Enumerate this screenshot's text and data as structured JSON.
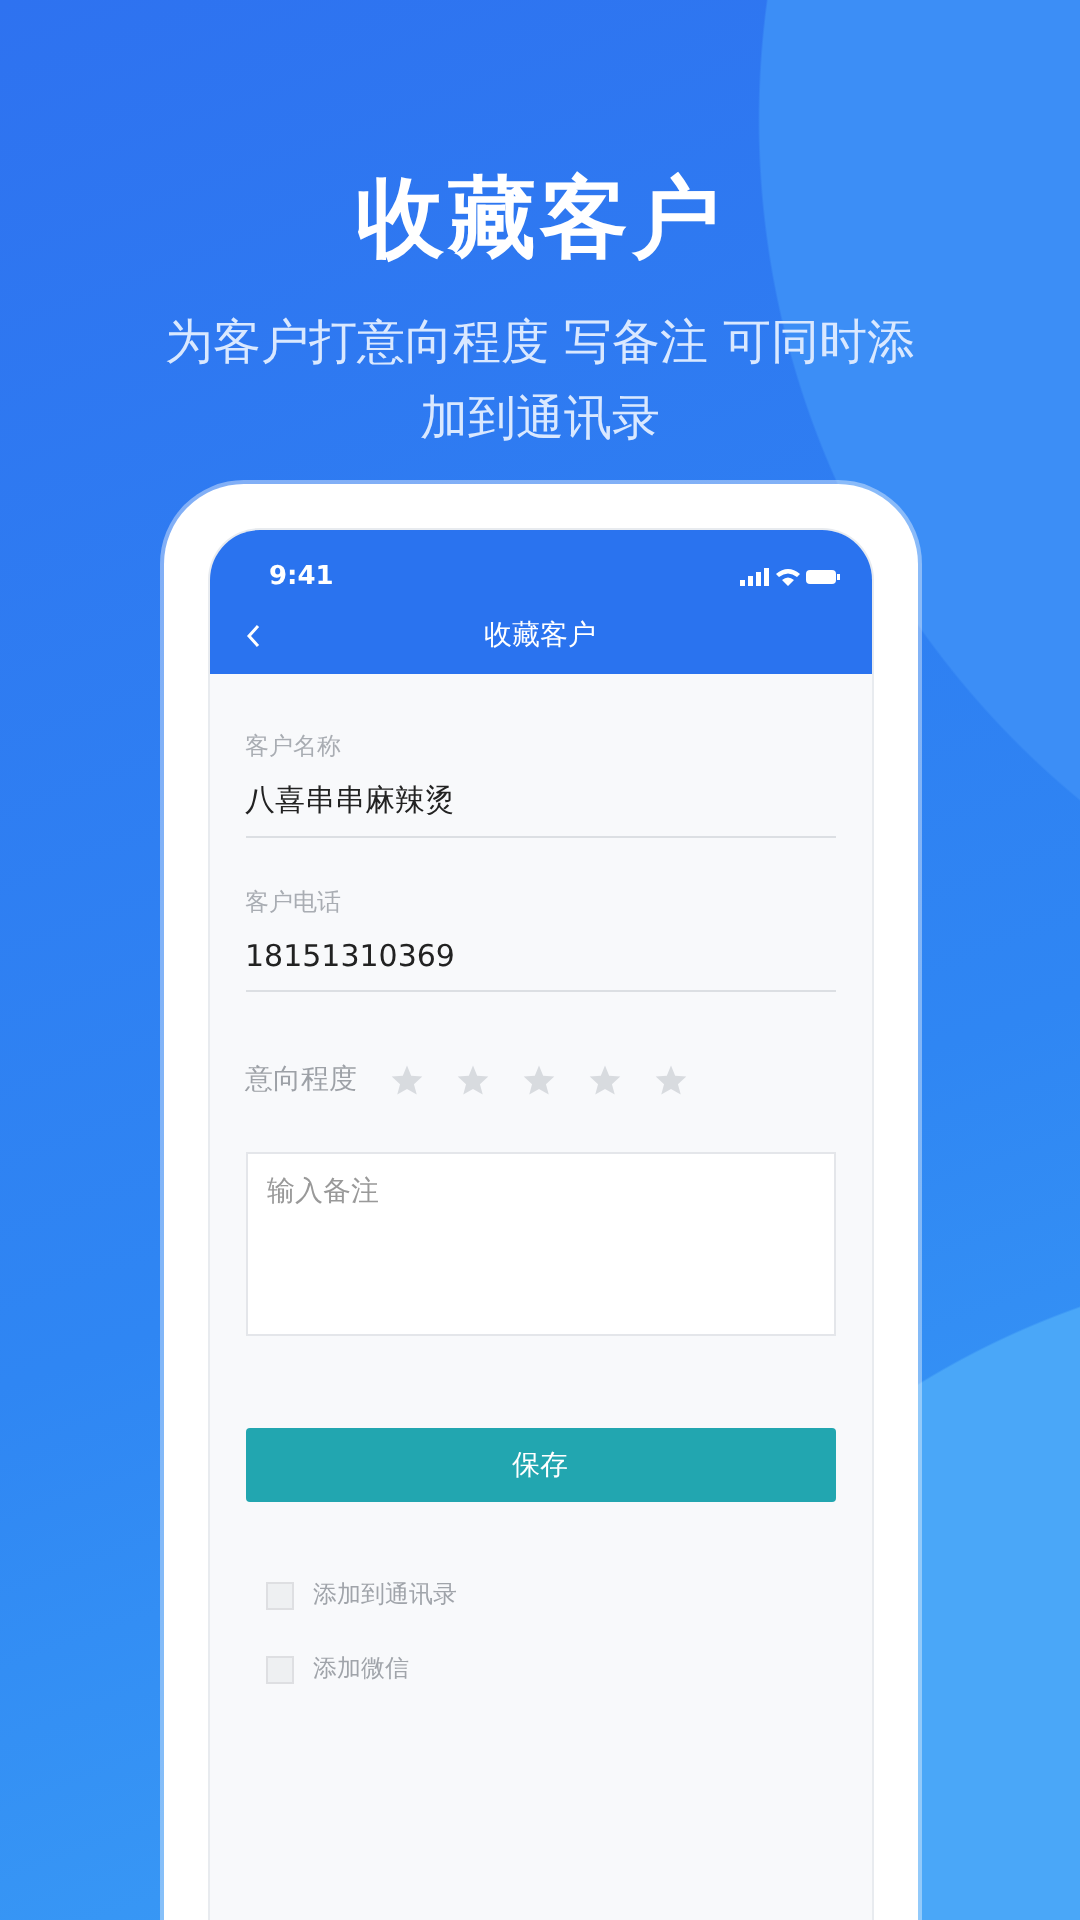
{
  "headline": "收藏客户",
  "subtitle": "为客户打意向程度 写备注 可同时添加到通讯录",
  "phone": {
    "time": "9:41",
    "nav_title": "收藏客户",
    "fields": [
      {
        "label": "客户名称",
        "value": "八喜串串麻辣烫"
      },
      {
        "label": "客户电话",
        "value": "18151310369"
      }
    ],
    "rating": {
      "label": "意向程度",
      "stars": 0
    },
    "note": {
      "placeholder": "输入备注"
    },
    "save_button": "保存",
    "options": [
      {
        "label": "添加到通讯录",
        "checked": false
      },
      {
        "label": "添加微信",
        "checked": false
      }
    ]
  }
}
